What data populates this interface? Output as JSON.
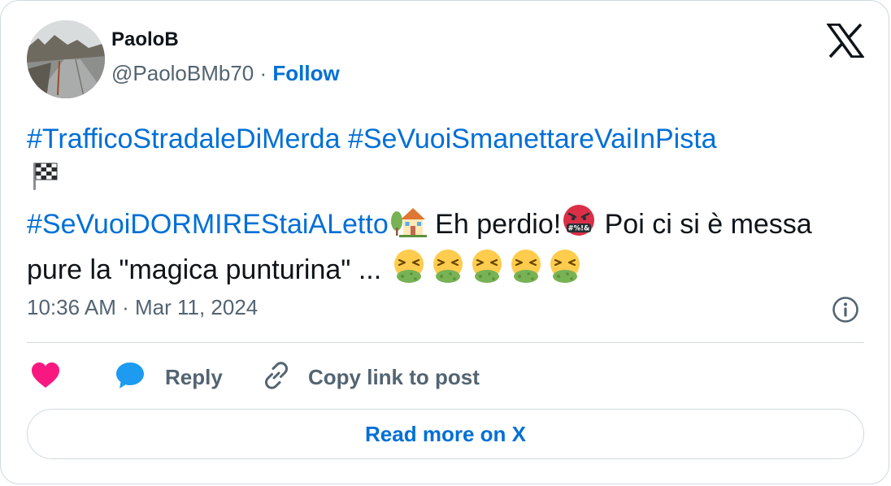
{
  "author": {
    "name": "PaoloB",
    "handle": "@PaoloBMb70",
    "separator": "·",
    "follow_label": "Follow"
  },
  "tweet": {
    "hashtag_1": "#TrafficoStradaleDiMerda",
    "hashtag_2": "#SeVuoiSmanettareVaiInPista",
    "hashtag_3": "#SeVuoiDORMIREStaiALetto",
    "text_1": " Eh perdio!",
    "text_2": " Poi ci si è messa pure la \"magica punturina\" ... ",
    "emojis": [
      "chequered-flag",
      "house-with-garden",
      "face-with-symbols-on-mouth",
      "face-vomiting",
      "face-vomiting",
      "face-vomiting",
      "face-vomiting",
      "face-vomiting"
    ]
  },
  "meta": {
    "time": "10:36 AM",
    "separator": " · ",
    "date": "Mar 11, 2024"
  },
  "actions": {
    "reply_label": "Reply",
    "copy_label": "Copy link to post"
  },
  "read_more_label": "Read more on X",
  "colors": {
    "link": "#006fd6",
    "secondary_text": "#536471",
    "border": "#cfd9de",
    "heart": "#f91880",
    "reply_bubble": "#1d9bf0"
  }
}
